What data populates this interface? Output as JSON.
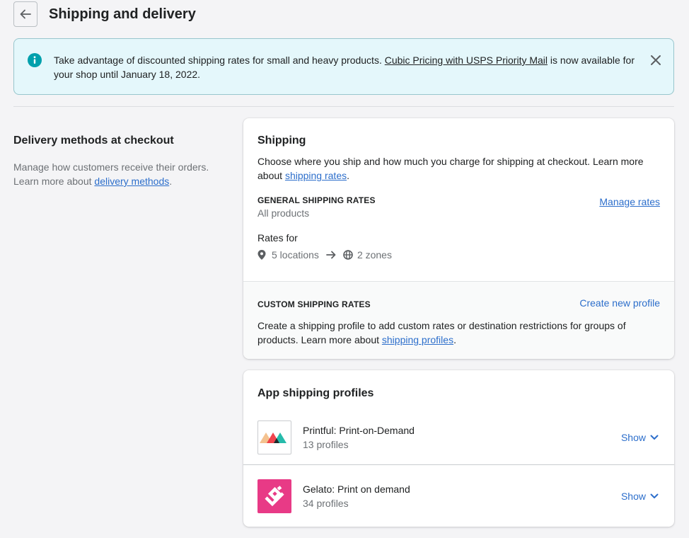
{
  "header": {
    "title": "Shipping and delivery",
    "back_icon": "arrow-left-icon"
  },
  "banner": {
    "icon": "info-icon",
    "text_before": "Take advantage of discounted shipping rates for small and heavy products. ",
    "link": "Cubic Pricing with USPS Priority Mail",
    "text_after": " is now available for your shop until January 18, 2022.",
    "close_icon": "close-icon",
    "colors": {
      "background": "#e4f7fb",
      "border": "#98c6cd",
      "icon": "#00a0ac"
    }
  },
  "annotation": {
    "title": "Delivery methods at checkout",
    "desc_before": "Manage how customers receive their orders. Learn more about ",
    "desc_link": "delivery methods",
    "desc_after": "."
  },
  "shipping": {
    "title": "Shipping",
    "desc_before": "Choose where you ship and how much you charge for shipping at checkout. Learn more about ",
    "desc_link": "shipping rates",
    "desc_after": ".",
    "general": {
      "heading": "GENERAL SHIPPING RATES",
      "subtitle": "All products",
      "manage_link": "Manage rates",
      "rates_for_label": "Rates for",
      "locations": "5 locations",
      "zones": "2 zones",
      "location_icon": "location-pin-icon",
      "arrow_icon": "arrow-right-icon",
      "zones_icon": "globe-icon"
    },
    "custom": {
      "heading": "CUSTOM SHIPPING RATES",
      "create_link": "Create new profile",
      "desc_before": "Create a shipping profile to add custom rates or destination restrictions for groups of products. Learn more about ",
      "desc_link": "shipping profiles",
      "desc_after": "."
    }
  },
  "apps": {
    "title": "App shipping profiles",
    "items": [
      {
        "name": "Printful: Print-on-Demand",
        "count": "13 profiles",
        "action": "Show",
        "logo": "printful-logo-icon"
      },
      {
        "name": "Gelato: Print on demand",
        "count": "34 profiles",
        "action": "Show",
        "logo": "gelato-logo-icon"
      }
    ]
  },
  "colors": {
    "link": "#2c6ecb",
    "page_bg": "#f4f4f6",
    "text": "#202223",
    "subdued": "#6d7175",
    "gelato_brand": "#e83a86"
  }
}
